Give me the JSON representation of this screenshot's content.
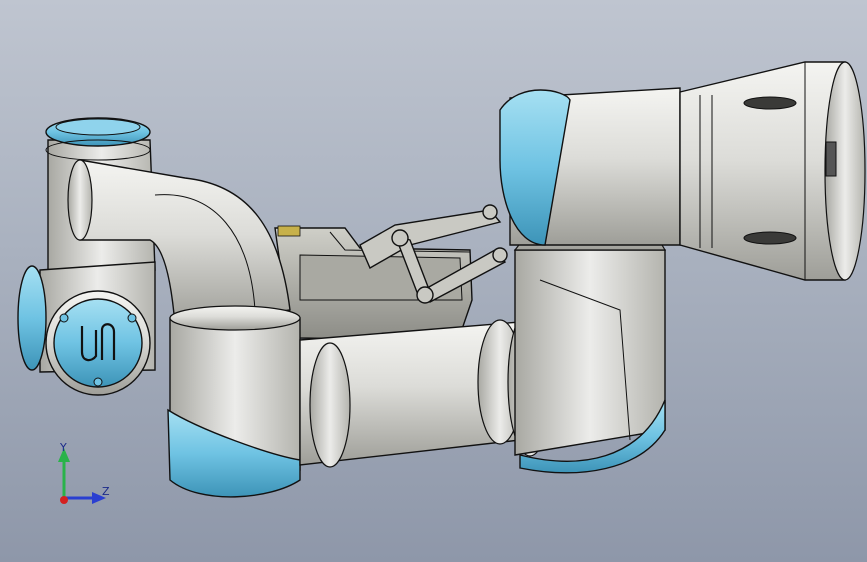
{
  "viewport": {
    "background_top": "#bfc5d0",
    "background_bottom": "#8e97a9"
  },
  "model": {
    "body_color": "#dcdcd8",
    "cap_color": "#6fc3e3",
    "outline_color": "#111111",
    "motor_color": "#bdbdb6"
  },
  "triad": {
    "y_label": "Y",
    "z_label": "Z",
    "y_axis_color": "#29b34a",
    "z_axis_color": "#2a3fd1",
    "x_origin_color": "#d42020"
  },
  "icons": {
    "logo": "ur-logo-icon",
    "triad": "axis-triad-icon"
  }
}
